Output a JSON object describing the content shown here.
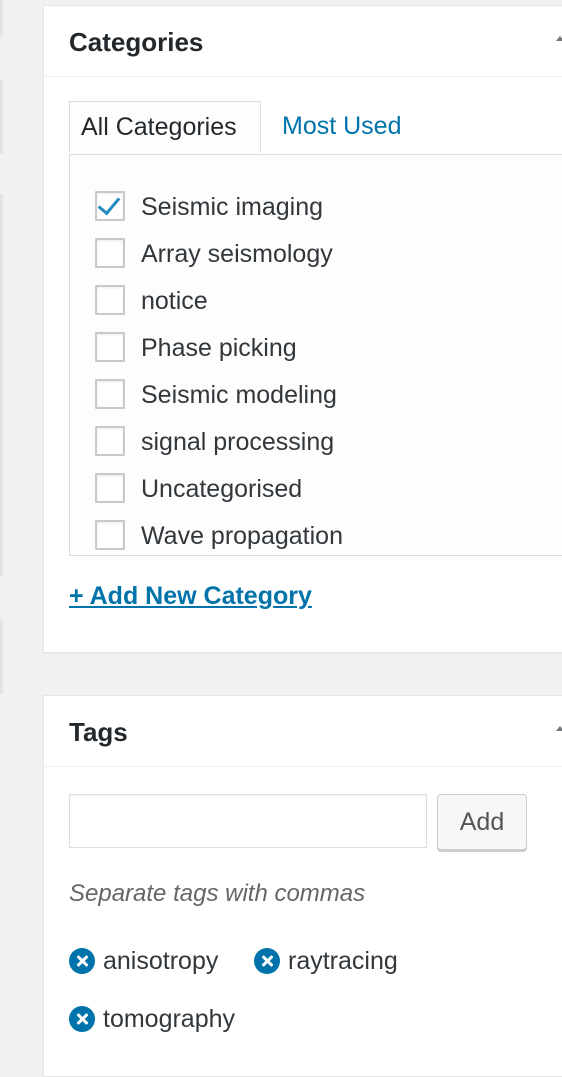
{
  "categories_box": {
    "title": "Categories",
    "tabs": [
      {
        "label": "All Categories",
        "active": true
      },
      {
        "label": "Most Used",
        "active": false
      }
    ],
    "items": [
      {
        "label": "Seismic imaging",
        "checked": true
      },
      {
        "label": "Array seismology",
        "checked": false
      },
      {
        "label": "notice",
        "checked": false
      },
      {
        "label": "Phase picking",
        "checked": false
      },
      {
        "label": "Seismic modeling",
        "checked": false
      },
      {
        "label": "signal processing",
        "checked": false
      },
      {
        "label": "Uncategorised",
        "checked": false
      },
      {
        "label": "Wave propagation",
        "checked": false
      }
    ],
    "add_new_label": "+ Add New Category"
  },
  "tags_box": {
    "title": "Tags",
    "input_value": "",
    "add_button_label": "Add",
    "hint": "Separate tags with commas",
    "tags": [
      "anisotropy",
      "raytracing",
      "tomography"
    ]
  },
  "colors": {
    "link": "#0073aa",
    "check": "#1e8cbe",
    "background": "#f1f1f1"
  }
}
